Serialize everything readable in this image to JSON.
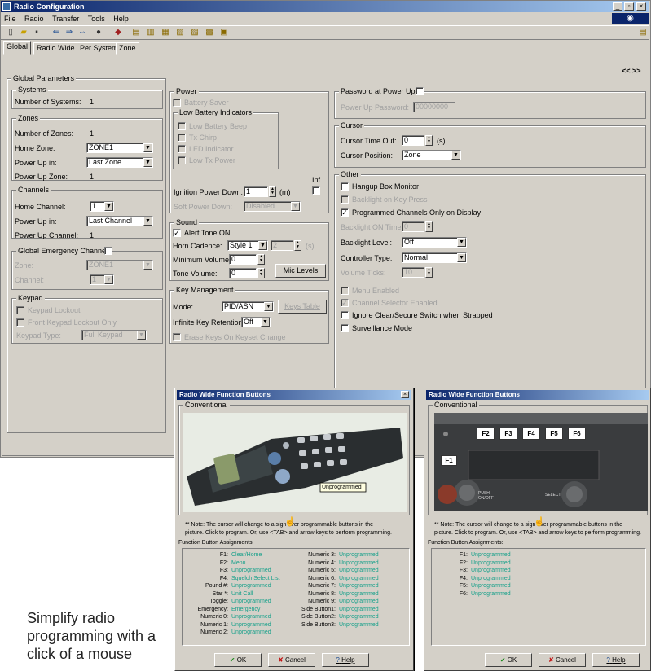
{
  "app": {
    "title": "Radio Configuration"
  },
  "menu": [
    "File",
    "Radio",
    "Transfer",
    "Tools",
    "Help"
  ],
  "tabs": [
    "Global",
    "Radio Wide",
    "Per System",
    "Zone"
  ],
  "nav_arrows": "<<  >>",
  "global_parameters": {
    "title": "Global Parameters",
    "systems": {
      "title": "Systems",
      "number_label": "Number of Systems:",
      "number_value": "1"
    },
    "zones": {
      "title": "Zones",
      "number_label": "Number of Zones:",
      "number_value": "1",
      "home_label": "Home Zone:",
      "home_value": "ZONE1",
      "power_up_in_label": "Power Up in:",
      "power_up_in_value": "Last Zone",
      "power_up_zone_label": "Power Up Zone:",
      "power_up_zone_value": "1"
    },
    "channels": {
      "title": "Channels",
      "home_label": "Home Channel:",
      "home_value": "1",
      "power_up_in_label": "Power Up in:",
      "power_up_in_value": "Last Channel",
      "power_up_channel_label": "Power Up Channel:",
      "power_up_channel_value": "1"
    },
    "emergency": {
      "title": "Global Emergency Channel",
      "zone_label": "Zone:",
      "zone_value": "ZONE1",
      "channel_label": "Channel:",
      "channel_value": "1"
    },
    "keypad": {
      "title": "Keypad",
      "lockout": "Keypad Lockout",
      "front_lockout": "Front Keypad Lockout Only",
      "type_label": "Keypad Type:",
      "type_value": "Full Keypad"
    }
  },
  "power": {
    "title": "Power",
    "battery_saver": "Battery Saver",
    "low_battery_title": "Low Battery Indicators",
    "low_battery_beep": "Low Battery Beep",
    "tx_chirp": "Tx Chirp",
    "led_indicator": "LED Indicator",
    "low_tx_power": "Low Tx Power",
    "ignition_label": "Ignition Power Down:",
    "ignition_value": "1",
    "ignition_unit": "(m)",
    "inf_label": "Inf.",
    "soft_label": "Soft Power Down:",
    "soft_value": "Disabled"
  },
  "sound": {
    "title": "Sound",
    "alert_tone": "Alert Tone ON",
    "horn_label": "Horn Cadence:",
    "horn_value": "Style 1",
    "horn_num": "2",
    "horn_unit": "(s)",
    "min_vol_label": "Minimum Volume:",
    "min_vol_value": "0",
    "tone_vol_label": "Tone Volume:",
    "tone_vol_value": "0",
    "mic_levels": "Mic Levels"
  },
  "key_management": {
    "title": "Key Management",
    "mode_label": "Mode:",
    "mode_value": "PID/ASN",
    "keys_table": "Keys Table",
    "retention_label": "Infinite Key Retention:",
    "retention_value": "Off",
    "erase_keys": "Erase Keys On Keyset Change"
  },
  "password": {
    "title": "Password at Power Up",
    "label": "Power Up Password:",
    "value": "00000000"
  },
  "cursor": {
    "title": "Cursor",
    "timeout_label": "Cursor Time Out:",
    "timeout_value": "0",
    "timeout_unit": "(s)",
    "position_label": "Cursor Position:",
    "position_value": "Zone"
  },
  "other": {
    "title": "Other",
    "hangup": "Hangup Box Monitor",
    "backlight_keypress": "Backlight on Key Press",
    "programmed_only": "Programmed Channels Only on Display",
    "backlight_time_label": "Backlight ON Time:",
    "backlight_time_value": "0",
    "backlight_level_label": "Backlight Level:",
    "backlight_level_value": "Off",
    "controller_label": "Controller Type:",
    "controller_value": "Normal",
    "volume_ticks_label": "Volume Ticks:",
    "volume_ticks_value": "10",
    "menu_enabled": "Menu Enabled",
    "channel_selector": "Channel Selector Enabled",
    "ignore_clear": "Ignore Clear/Secure Switch when Strapped",
    "surveillance": "Surveillance Mode"
  },
  "dialog1": {
    "title": "Radio Wide Function Buttons",
    "group": "Conventional",
    "tooltip": "Unprogrammed",
    "note_line1": "** Note:  The cursor will change to a      sign over programmable buttons in the",
    "note_line2": "picture.  Click to program.  Or, use <TAB> and arrow keys to perform programming.",
    "assign_title": "Function Button Assignments:",
    "left": [
      [
        "F1:",
        "Clear/Home"
      ],
      [
        "F2:",
        "Menu"
      ],
      [
        "F3:",
        "Unprogrammed"
      ],
      [
        "F4:",
        "Squelch Select List"
      ],
      [
        "Pound #:",
        "Unprogrammed"
      ],
      [
        "Star *:",
        "Unit Call"
      ],
      [
        "Toggle:",
        "Unprogrammed"
      ],
      [
        "Emergency:",
        "Emergency"
      ],
      [
        "Numeric 0:",
        "Unprogrammed"
      ],
      [
        "Numeric 1:",
        "Unprogrammed"
      ],
      [
        "Numeric 2:",
        "Unprogrammed"
      ]
    ],
    "right": [
      [
        "Numeric 3:",
        "Unprogrammed"
      ],
      [
        "Numeric 4:",
        "Unprogrammed"
      ],
      [
        "Numeric 5:",
        "Unprogrammed"
      ],
      [
        "Numeric 6:",
        "Unprogrammed"
      ],
      [
        "Numeric 7:",
        "Unprogrammed"
      ],
      [
        "Numeric 8:",
        "Unprogrammed"
      ],
      [
        "Numeric 9:",
        "Unprogrammed"
      ],
      [
        "Side Button1:",
        "Unprogrammed"
      ],
      [
        "Side Button2:",
        "Unprogrammed"
      ],
      [
        "Side Button3:",
        "Unprogrammed"
      ]
    ],
    "ok": "OK",
    "cancel": "Cancel",
    "help": "Help"
  },
  "dialog2": {
    "title": "Radio Wide Function Buttons",
    "group": "Conventional",
    "keys": [
      "F2",
      "F3",
      "F4",
      "F5",
      "F6"
    ],
    "f1": "F1",
    "push_label": "PUSH ON/OFF",
    "select_label": "SELECT",
    "note_line1": "** Note:  The cursor will change to a      sign over programmable buttons in the",
    "note_line2": "picture.  Click to program.  Or, use <TAB> and arrow keys to perform programming.",
    "assign_title": "Function Button Assignments:",
    "items": [
      [
        "F1:",
        "Unprogrammed"
      ],
      [
        "F2:",
        "Unprogrammed"
      ],
      [
        "F3:",
        "Unprogrammed"
      ],
      [
        "F4:",
        "Unprogrammed"
      ],
      [
        "F5:",
        "Unprogrammed"
      ],
      [
        "F6:",
        "Unprogrammed"
      ]
    ],
    "ok": "OK",
    "cancel": "Cancel",
    "help": "Help"
  },
  "caption": "Simplify radio programming with a click of a mouse"
}
